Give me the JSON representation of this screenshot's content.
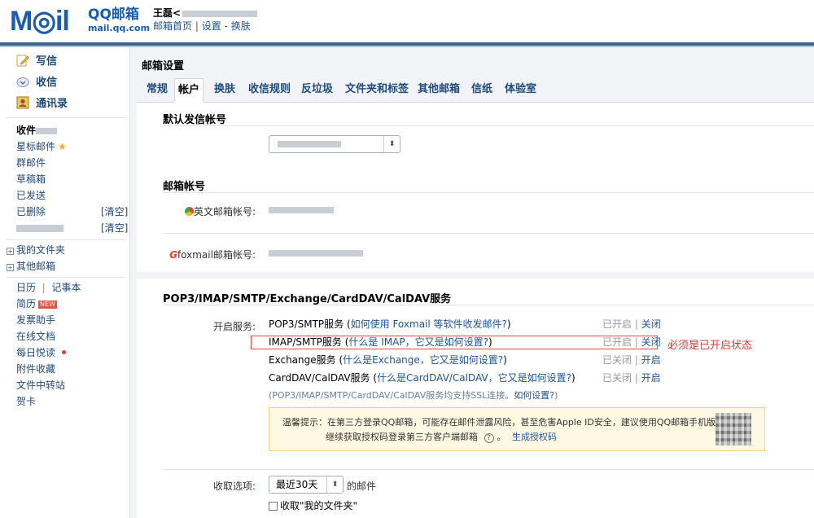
{
  "header": {
    "logo_text": "M◎il",
    "brand": "QQ邮箱",
    "domain": "mail.qq.com",
    "user_name": "王磊<",
    "links": [
      "邮箱首页",
      "设置",
      "换肤"
    ]
  },
  "sidebar": {
    "main": [
      {
        "label": "写信",
        "icon": "compose-icon"
      },
      {
        "label": "收信",
        "icon": "inbox-icon"
      },
      {
        "label": "通讯录",
        "icon": "contacts-icon"
      }
    ],
    "folders": {
      "inbox": "收件",
      "starred": "星标邮件",
      "group": "群邮件",
      "drafts": "草稿箱",
      "sent": "已发送",
      "deleted": "已删除",
      "clear": "[清空]",
      "clear2": "[清空]"
    },
    "trees": {
      "my_folders": "我的文件夹",
      "other_mail": "其他邮箱",
      "plus": "+"
    },
    "tools": {
      "calendar": "日历",
      "notebook": "记事本",
      "resume": "简历",
      "new_badge": "NEW",
      "invoice": "发票助手",
      "docs": "在线文档",
      "daily": "每日悦读",
      "attachments": "附件收藏",
      "transfer": "文件中转站",
      "cards": "贺卡"
    }
  },
  "main": {
    "title": "邮箱设置",
    "tabs": [
      "常规",
      "帐户",
      "换肤",
      "收信规则",
      "反垃圾",
      "文件夹和标签",
      "其他邮箱",
      "信纸",
      "体验室"
    ],
    "active_tab": "帐户",
    "default_sender": {
      "title": "默认发信帐号"
    },
    "accounts": {
      "title": "邮箱帐号",
      "english_label": "英文邮箱帐号:",
      "foxmail_label": "foxmail邮箱帐号:"
    },
    "services": {
      "title": "POP3/IMAP/SMTP/Exchange/CardDAV/CalDAV服务",
      "open_label": "开启服务:",
      "rows": [
        {
          "name": "POP3/SMTP服务",
          "help": "如何使用 Foxmail 等软件收发邮件?",
          "status": "已开启",
          "action": "关闭"
        },
        {
          "name": "IMAP/SMTP服务",
          "help": "什么是 IMAP，它又是如何设置?",
          "status": "已开启",
          "action": "关闭"
        },
        {
          "name": "Exchange服务",
          "help": "什么是Exchange，它又是如何设置?",
          "status": "已关闭",
          "action": "开启"
        },
        {
          "name": "CardDAV/CalDAV服务",
          "help": "什么是CardDAV/CalDAV，它又是如何设置?",
          "status": "已关闭",
          "action": "开启"
        }
      ],
      "ssl_note": "(POP3/IMAP/SMTP/CardDAV/CalDAV服务均支持SSL连接。",
      "ssl_link": "如何设置?",
      "ssl_end": ")",
      "annotation": "必须是已开启状态",
      "tip_line1": "温馨提示：在第三方登录QQ邮箱，可能存在邮件泄露风险，甚至危害Apple ID安全，建议使用QQ邮箱手机版登录。",
      "tip_line2": "继续获取授权码登录第三方客户端邮箱",
      "tip_help": "?",
      "tip_link": "生成授权码"
    },
    "receive": {
      "label": "收取选项:",
      "select_value": "最近30天",
      "suffix": "的邮件",
      "checkbox_label": "收取\"我的文件夹\""
    }
  },
  "colors": {
    "brand_blue": "#1a5db0",
    "link_blue": "#1e5494",
    "highlight_red": "#e14a4a",
    "tip_bg": "#fff9e3"
  }
}
